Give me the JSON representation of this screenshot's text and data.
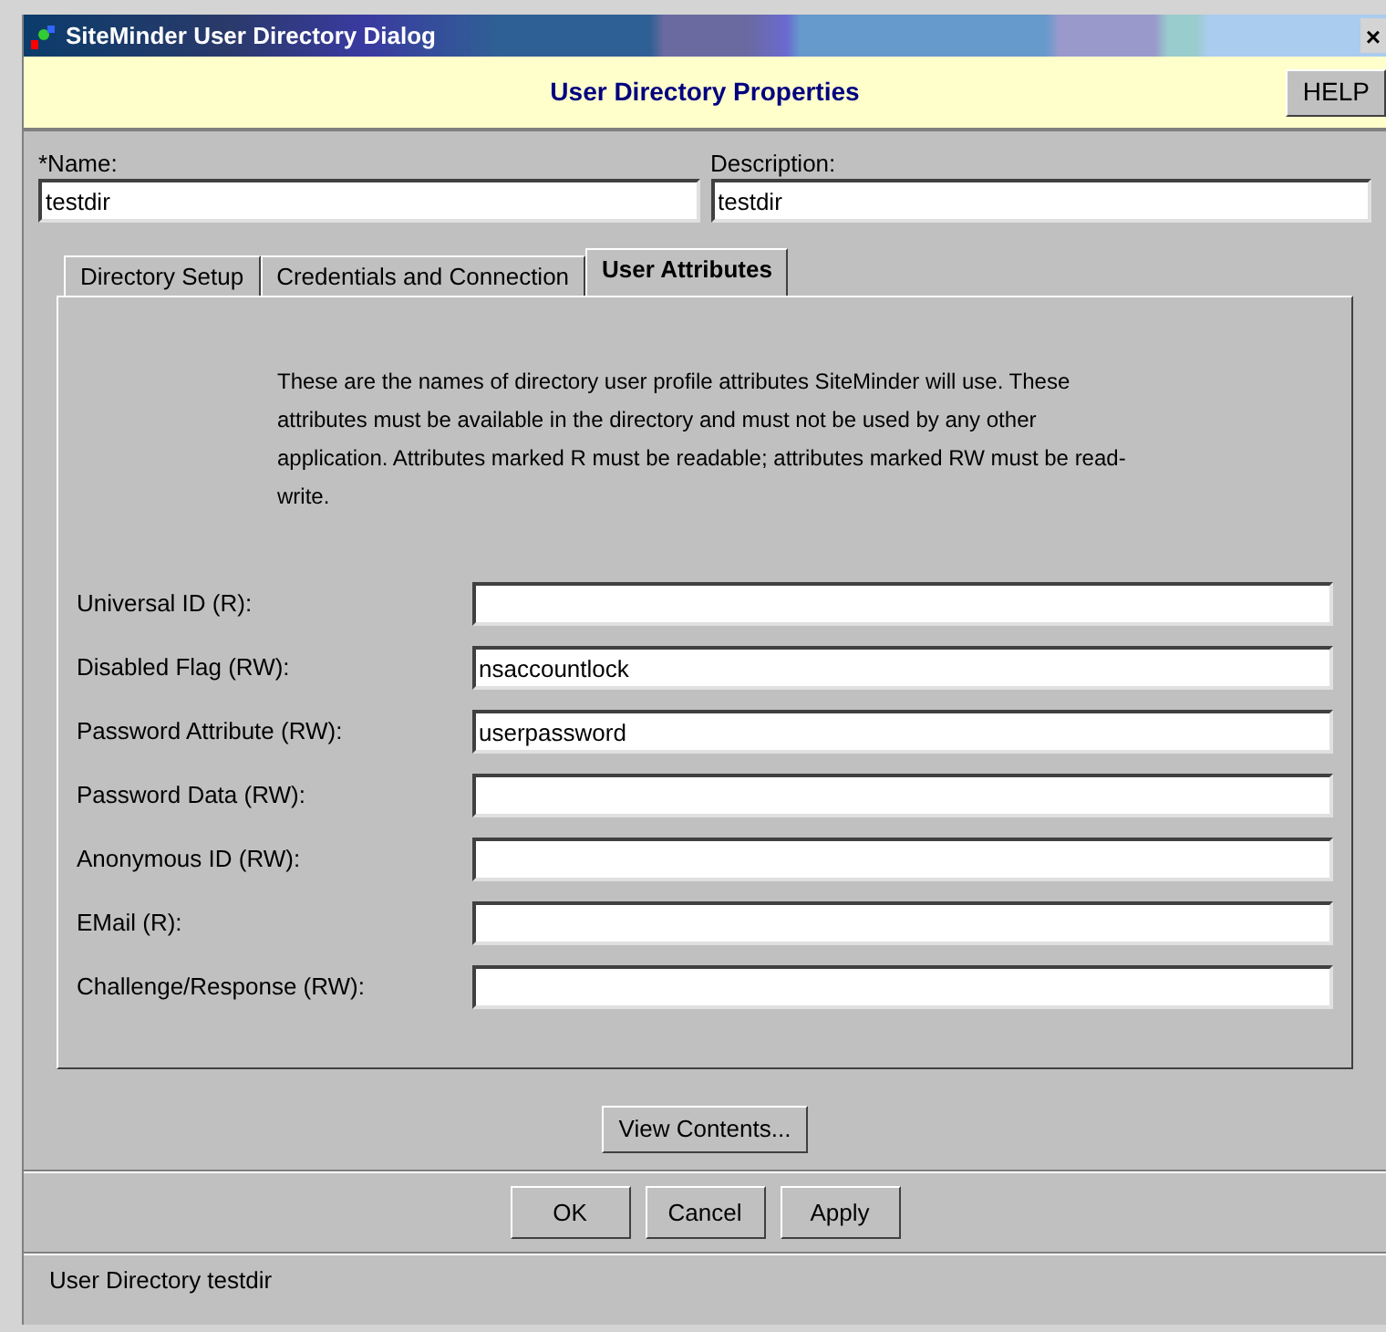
{
  "window": {
    "title": "SiteMinder User Directory Dialog",
    "close": "×"
  },
  "header": {
    "title": "User Directory Properties",
    "help": "HELP"
  },
  "name_field": {
    "label": "*Name:",
    "value": "testdir"
  },
  "description_field": {
    "label": "Description:",
    "value": "testdir"
  },
  "tabs": [
    {
      "label": "Directory Setup",
      "selected": false
    },
    {
      "label": "Credentials and Connection",
      "selected": false
    },
    {
      "label": "User Attributes",
      "selected": true
    }
  ],
  "intro": "These are the names of directory user profile attributes SiteMinder will use.  These attributes must be available in the directory and must not be used by any other application. Attributes marked R must be readable; attributes marked RW must be read-write.",
  "attributes": [
    {
      "label": "Universal ID (R):"
    },
    {
      "label": "Disabled Flag (RW):",
      "value": "nsaccountlock"
    },
    {
      "label": "Password Attribute (RW):",
      "value": "userpassword"
    },
    {
      "label": "Password Data (RW):"
    },
    {
      "label": "Anonymous ID (RW):"
    },
    {
      "label": "EMail (R):"
    },
    {
      "label": "Challenge/Response (RW):"
    }
  ],
  "view_button": "View Contents...",
  "buttons": [
    "OK",
    "Cancel",
    "Apply"
  ],
  "status_bar": "User Directory testdir"
}
